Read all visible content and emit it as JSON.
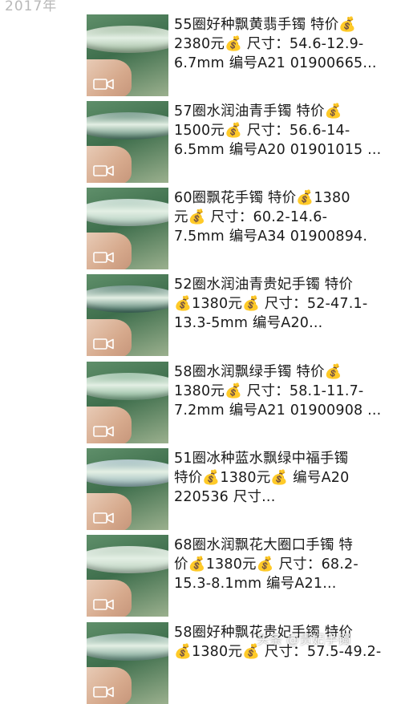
{
  "timeline": {
    "year": "2017年"
  },
  "posts": [
    {
      "text": "55圈好种飘黄翡手镯 特价💰\n2380元💰 尺寸：54.6-12.9-\n6.7mm 编号A21 01900665..."
    },
    {
      "text": "57圈水润油青手镯 特价💰\n1500元💰 尺寸：56.6-14-\n6.5mm 编号A20 01901015 ..."
    },
    {
      "text": "60圈飘花手镯 特价💰1380\n元💰 尺寸：60.2-14.6-\n7.5mm 编号A34 01900894."
    },
    {
      "text": "52圈水润油青贵妃手镯 特价\n💰1380元💰 尺寸：52-47.1-\n13.3-5mm 编号A20..."
    },
    {
      "text": "58圈水润飘绿手镯 特价💰\n1380元💰 尺寸：58.1-11.7-\n7.2mm 编号A21 01900908 ..."
    },
    {
      "text": "51圈冰种蓝水飘绿中福手镯\n特价💰1380元💰 编号A20\n220536 尺寸..."
    },
    {
      "text": "68圈水润飘花大圈口手镯 特\n价💰1380元💰 尺寸：68.2-\n15.3-8.1mm 编号A21..."
    },
    {
      "text": "58圈好种飘花贵妃手镯 特价\n💰1380元💰 尺寸：57.5-49.2-"
    }
  ],
  "watermark": "头条 @贵妃手镯",
  "colors": {
    "thumb_tones": [
      "#9bb79a",
      "#4f7e6a",
      "#a9c8b9",
      "#3f6f60",
      "#7fae8e",
      "#8fb0b4",
      "#b7cdbb",
      "#6e9a8a"
    ]
  },
  "icons": {
    "video": "video-camera-icon"
  }
}
